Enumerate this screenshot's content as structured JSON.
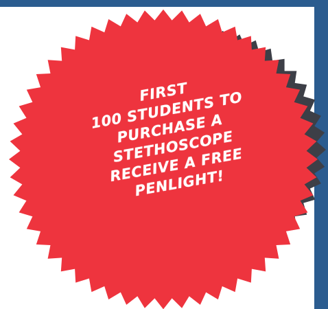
{
  "badge": {
    "lines": [
      "FIRST",
      "100 STUDENTS TO",
      "PURCHASE A",
      "STETHOSCOPE",
      "RECEIVE A FREE",
      "PENLIGHT!"
    ]
  },
  "colors": {
    "frame": "#2b5c8f",
    "badge": "#ee343e",
    "badge_shadow": "#3d3f47",
    "text": "#ffffff",
    "background": "#ffffff"
  }
}
